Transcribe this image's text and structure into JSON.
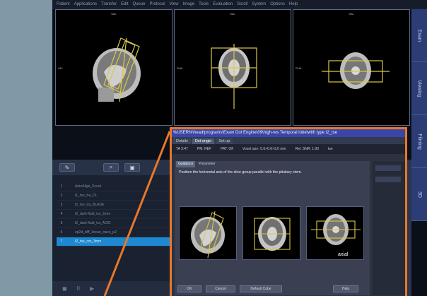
{
  "menubar": {
    "items": [
      "Patient",
      "Applications",
      "Transfer",
      "Edit",
      "Queue",
      "Protocol",
      "View",
      "Image",
      "Tools",
      "Evaluation",
      "Scroll",
      "System",
      "Options",
      "Help"
    ]
  },
  "viewports": [
    {
      "top_label": "SAL",
      "side_label": "AFL"
    },
    {
      "top_label": "SAL",
      "side_label": "RHA"
    },
    {
      "top_label": "SAL",
      "side_label": "RHA"
    }
  ],
  "right_tabs": [
    "Exam",
    "Viewing",
    "Filming",
    "3D"
  ],
  "lower_toolbar": {
    "button_glyphs": [
      "✎",
      "⌕",
      "▣"
    ]
  },
  "protocol_list": [
    {
      "num": "1",
      "icon": "",
      "name": "AutoAlign_Scout",
      "selected": false
    },
    {
      "num": "2",
      "icon": "",
      "name": "t1_tse_tra_DL",
      "selected": false
    },
    {
      "num": "3",
      "icon": "",
      "name": "t2_tse_tra_BLADE",
      "selected": false
    },
    {
      "num": "4",
      "icon": "",
      "name": "t2_dark-fluid_tra_3mm",
      "selected": false
    },
    {
      "num": "5",
      "icon": "",
      "name": "t2_dark-fluid_tra_ACIE",
      "selected": false
    },
    {
      "num": "6",
      "icon": "",
      "name": "ep2d_diff_3scan_trace_p2",
      "selected": false
    },
    {
      "num": "7",
      "icon": "",
      "name": "t2_tse_cor_3mm",
      "selected": true
    }
  ],
  "lower_bottom": {
    "glyphs": [
      "◼",
      "II",
      "▶"
    ]
  },
  "dialog": {
    "title": "%USER%\\head\\programs\\Exam Dot Engine\\09\\high-res Temporal lobe\\with type  t2_tse",
    "tabs": [
      "Details",
      "Dot engin",
      "Set up"
    ],
    "stats": {
      "ta": "TA 3:47",
      "pm": "PM: REF",
      "pat": "PAT: Off",
      "voxel": "Voxel size: 0.6×0.6×3.0 mm",
      "snr": "Rel. SNR: 1.00",
      "seq": "tse"
    },
    "guidance_tabs": [
      "Guidance",
      "Parameter"
    ],
    "instruction": "Position the horizontal axis of the slice group parallel with the pituitary stem.",
    "thumbnail_caption": "axial",
    "buttons": [
      "OK",
      "Cancel",
      "Default Cube",
      "Help"
    ]
  },
  "colors": {
    "accent_orange": "#e8782a",
    "title_bar": "#3946a8",
    "selection": "#1e88d0",
    "slice_box": "#d9c84a"
  }
}
